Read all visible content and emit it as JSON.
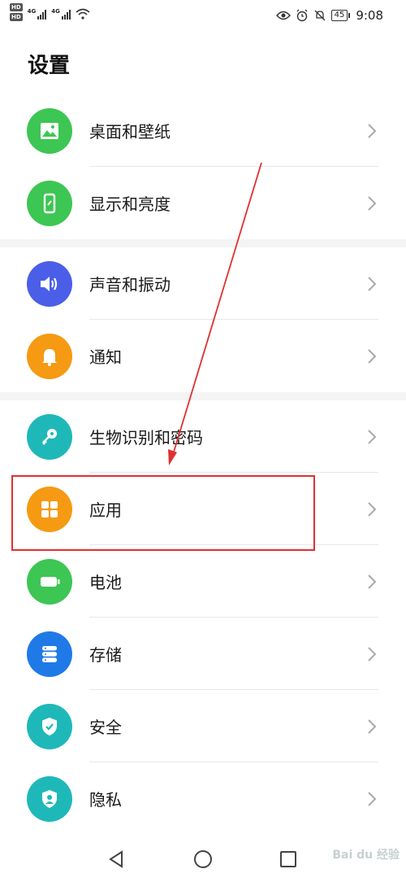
{
  "status_bar": {
    "hd_badges": [
      "HD",
      "HD"
    ],
    "network": [
      "4G",
      "4G"
    ],
    "battery": "45",
    "time": "9:08"
  },
  "page": {
    "title": "设置"
  },
  "groups": [
    [
      {
        "label": "桌面和壁纸",
        "icon": "wallpaper-icon",
        "color": "#3dc653"
      },
      {
        "label": "显示和亮度",
        "icon": "display-icon",
        "color": "#3dc653"
      }
    ],
    [
      {
        "label": "声音和振动",
        "icon": "sound-icon",
        "color": "#4a5ee8"
      },
      {
        "label": "通知",
        "icon": "bell-icon",
        "color": "#f59a12"
      }
    ],
    [
      {
        "label": "生物识别和密码",
        "icon": "key-icon",
        "color": "#1fb8b8"
      },
      {
        "label": "应用",
        "icon": "apps-icon",
        "color": "#f59a12"
      },
      {
        "label": "电池",
        "icon": "battery-icon",
        "color": "#3dc653"
      },
      {
        "label": "存储",
        "icon": "storage-icon",
        "color": "#1f7ae8"
      },
      {
        "label": "安全",
        "icon": "shield-check-icon",
        "color": "#1fb8b8"
      },
      {
        "label": "隐私",
        "icon": "privacy-icon",
        "color": "#1fb8b8"
      }
    ]
  ],
  "annotation": {
    "highlight_color": "#e03030"
  },
  "watermark": "Bai du 经验"
}
